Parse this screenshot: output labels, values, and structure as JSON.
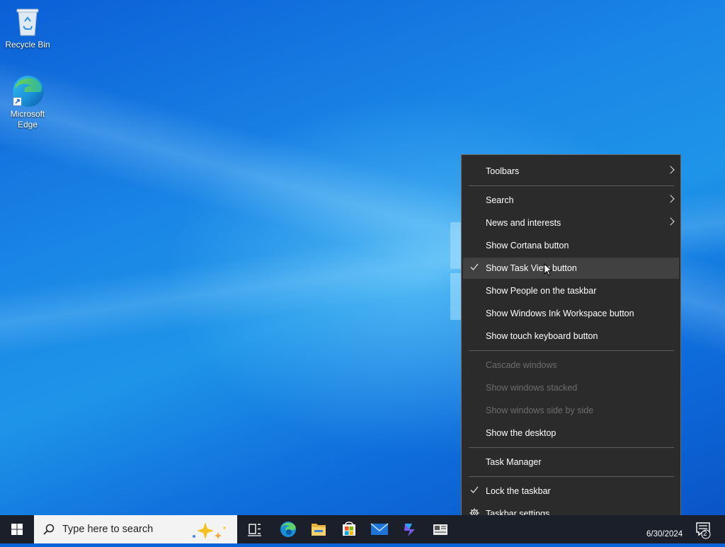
{
  "desktop": {
    "icons": [
      {
        "label": "Recycle Bin",
        "icon": "recycle-bin-icon"
      },
      {
        "label": "Microsoft Edge",
        "icon": "edge-icon"
      }
    ]
  },
  "context_menu": {
    "items": [
      {
        "label": "Toolbars",
        "submenu": true
      },
      {
        "label": "Search",
        "submenu": true
      },
      {
        "label": "News and interests",
        "submenu": true
      },
      {
        "label": "Show Cortana button"
      },
      {
        "label": "Show Task View button",
        "checked": true,
        "highlighted": true
      },
      {
        "label": "Show People on the taskbar"
      },
      {
        "label": "Show Windows Ink Workspace button"
      },
      {
        "label": "Show touch keyboard button"
      },
      {
        "label": "Cascade windows",
        "disabled": true
      },
      {
        "label": "Show windows stacked",
        "disabled": true
      },
      {
        "label": "Show windows side by side",
        "disabled": true
      },
      {
        "label": "Show the desktop"
      },
      {
        "label": "Task Manager"
      },
      {
        "label": "Lock the taskbar",
        "checked": true
      },
      {
        "label": "Taskbar settings",
        "icon": "gear-icon"
      }
    ]
  },
  "taskbar": {
    "search_placeholder": "Type here to search",
    "pinned": [
      "task-view-icon",
      "edge-icon",
      "file-explorer-icon",
      "microsoft-store-icon",
      "mail-icon",
      "copilot-icon",
      "news-icon"
    ],
    "clock_date": "6/30/2024",
    "notification_count": "2"
  },
  "colors": {
    "menu_bg": "#2b2b2b",
    "menu_hover": "#414141",
    "taskbar_bg": "#1b1f29",
    "desktop_accent": "#0a63d8"
  }
}
